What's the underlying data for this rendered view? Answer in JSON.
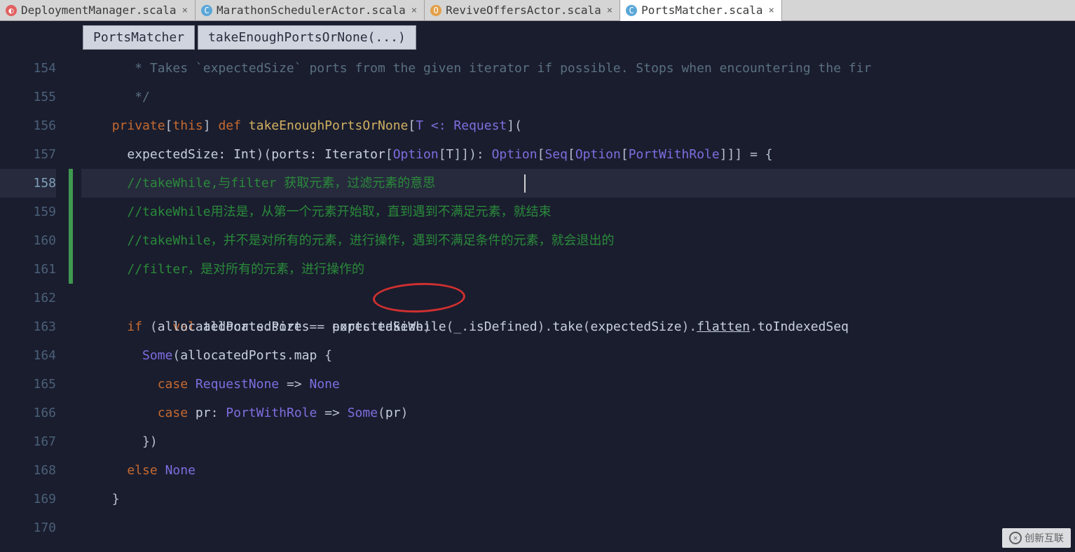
{
  "tabs": [
    {
      "label": "DeploymentManager.scala",
      "iconClass": "scala",
      "iconChar": "◐"
    },
    {
      "label": "MarathonSchedulerActor.scala",
      "iconClass": "blue",
      "iconChar": "C"
    },
    {
      "label": "ReviveOffersActor.scala",
      "iconClass": "orange",
      "iconChar": "O"
    },
    {
      "label": "PortsMatcher.scala",
      "iconClass": "blue",
      "iconChar": "C"
    }
  ],
  "activeTab": 3,
  "breadcrumbs": {
    "class": "PortsMatcher",
    "method": "takeEnoughPortsOrNone(...)"
  },
  "lineStart": 154,
  "currentLine": 158,
  "changeBarLines": [
    158,
    159,
    160,
    161
  ],
  "code": {
    "l154": " * Takes `expectedSize` ports from the given iterator if possible. Stops when encountering the fir",
    "l155": " */",
    "l156_kw1": "private",
    "l156_this": "this",
    "l156_kw2": "def",
    "l156_name": "takeEnoughPortsOrNone",
    "l156_tparam": "T <: Request",
    "l157_param1": "expectedSize: Int",
    "l157_param2": "ports: Iterator",
    "l157_opt": "Option",
    "l157_ret": "Option",
    "l157_seq": "Seq",
    "l157_opt2": "Option",
    "l157_pwr": "PortWithRole",
    "l158": "//takeWhile,与filter 获取元素，过滤元素的意思",
    "l159": "//takeWhile用法是，从第一个元素开始取，直到遇到不满足元素，就结束",
    "l160": "//takeWhile，并不是对所有的元素，进行操作，遇到不满足条件的元素，就会退出的",
    "l161": "//filter，是对所有的元素，进行操作的",
    "l162_val": "val",
    "l162_name": "allocatedPorts",
    "l162_ports": "ports",
    "l162_take": "takeWhile",
    "l162_isdef": "isDefined",
    "l162_take2": "take",
    "l162_es": "expectedSize",
    "l162_flat": "flatten",
    "l162_idx": "toIndexedSeq",
    "l163_if": "if",
    "l163_ap": "allocatedPorts",
    "l163_size": "size",
    "l163_es": "expectedSize",
    "l164_some": "Some",
    "l164_ap": "allocatedPorts",
    "l164_map": "map",
    "l165_case": "case",
    "l165_rn": "RequestNone",
    "l165_none": "None",
    "l166_case": "case",
    "l166_pr": "pr",
    "l166_pwr": "PortWithRole",
    "l166_some": "Some",
    "l166_prv": "pr",
    "l167": "})",
    "l168_else": "else",
    "l168_none": "None",
    "l169": "}"
  },
  "watermark": "创新互联"
}
